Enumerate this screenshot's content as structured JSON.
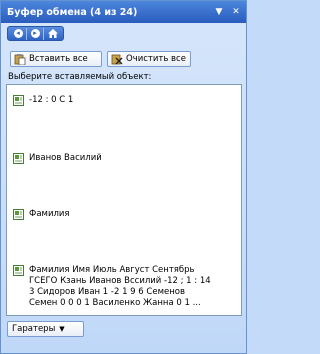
{
  "titlebar": {
    "title": "Буфер обмена (4 из 24)",
    "menu_icon": "dropdown-arrow-icon",
    "close_icon": "close-icon"
  },
  "navbar": {
    "back_icon": "back-arrow-icon",
    "forward_icon": "forward-arrow-icon",
    "home_icon": "home-icon"
  },
  "toolbar": {
    "paste_all_label": "Вставить все",
    "clear_all_label": "Очистить все"
  },
  "prompt": "Выберите вставляемый объект:",
  "items": [
    {
      "text": "-12 : 0 С 1",
      "icon": "word-document-icon"
    },
    {
      "text": "Иванов Василий",
      "icon": "word-document-icon"
    },
    {
      "text": "Фамилия",
      "icon": "word-document-icon"
    },
    {
      "text": "Фамилия Имя Июль Август Сентябрь\nГСЕГО Кзань Иванов Вссилий -12 ; 1 : 14\n3 Сидоров Иван 1 -2 1 9 6 Семенов\nСемен 0 0 0 1 Василенко Жанна 0 1 ...",
      "icon": "word-document-icon"
    }
  ],
  "footer": {
    "options_label": "Гаратеры"
  },
  "colors": {
    "title_bg": "#2a5bbd",
    "pane_bg": "#c3daf9",
    "list_bg": "#ffffff"
  }
}
